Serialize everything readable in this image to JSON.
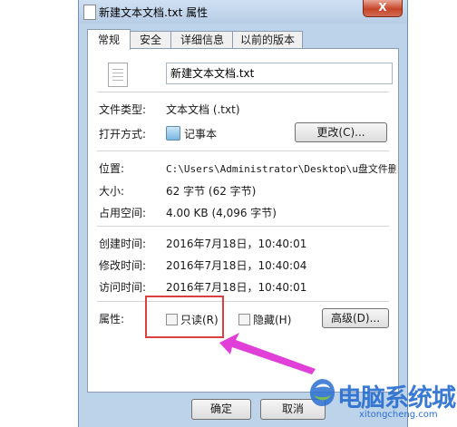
{
  "window": {
    "title": "新建文本文档.txt 属性",
    "close_label": "X"
  },
  "tabs": [
    {
      "label": "常规",
      "active": true
    },
    {
      "label": "安全",
      "active": false
    },
    {
      "label": "详细信息",
      "active": false
    },
    {
      "label": "以前的版本",
      "active": false
    }
  ],
  "general": {
    "file_name": "新建文本文档.txt",
    "file_type_label": "文件类型:",
    "file_type_value": "文本文档 (.txt)",
    "open_with_label": "打开方式:",
    "open_with_value": "记事本",
    "change_button": "更改(C)...",
    "location_label": "位置:",
    "location_value": "C:\\Users\\Administrator\\Desktop\\u盘文件删不",
    "size_label": "大小:",
    "size_value": "62 字节 (62 字节)",
    "disk_size_label": "占用空间:",
    "disk_size_value": "4.00 KB (4,096 字节)",
    "created_label": "创建时间:",
    "created_value": "2016年7月18日，10:40:01",
    "modified_label": "修改时间:",
    "modified_value": "2016年7月18日，10:40:04",
    "accessed_label": "访问时间:",
    "accessed_value": "2016年7月18日，10:40:01",
    "attributes_label": "属性:",
    "readonly_label": "只读(R)",
    "readonly_checked": false,
    "hidden_label": "隐藏(H)",
    "hidden_checked": false,
    "advanced_button": "高级(D)..."
  },
  "footer": {
    "ok_button": "确定",
    "cancel_button": "取消"
  },
  "watermark": {
    "brand": "电脑系统城",
    "url": "xitongcheng.com"
  },
  "colors": {
    "highlight": "#d94040",
    "arrow": "#e040d8",
    "watermark": "#2a6fd0"
  }
}
